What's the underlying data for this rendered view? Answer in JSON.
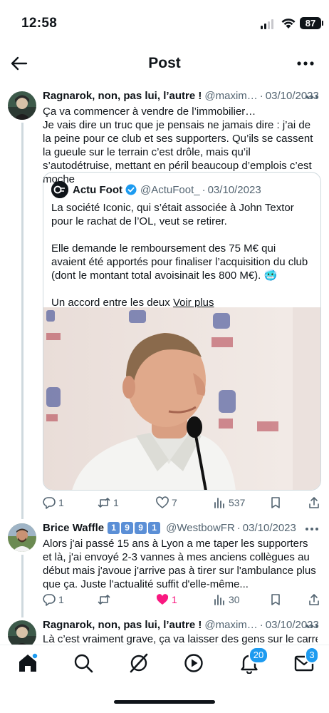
{
  "status_bar": {
    "time": "12:58",
    "battery": "87"
  },
  "header": {
    "title": "Post"
  },
  "tweets": [
    {
      "name": "Ragnarok, non, pas lui, l’autre !",
      "handle": "@maxim…",
      "date": "03/10/2023",
      "lines": [
        "Ça va commencer à vendre de l’immobilier…",
        "Je vais dire un truc que je pensais ne jamais dire : j’ai de la peine pour ce club et ses supporters. Qu’ils se cassent la gueule sur le terrain c’est drôle, mais qu’il s’autodétruise, mettant en péril beaucoup d’emplois c’est moche"
      ],
      "quote": {
        "name": "Actu Foot",
        "handle": "@ActuFoot_",
        "date": "03/10/2023",
        "para1": "La société Iconic, qui s’était associée à John Textor pour le rachat de l’OL, veut se retirer.",
        "para2": "Elle demande le remboursement des 75 M€ qui avaient été apportés pour finaliser l’acquisition du club (dont le montant total avoisinait les 800 M€). 🥶",
        "para3": "Un accord entre les deux",
        "more": "Voir plus"
      },
      "stats": {
        "replies": "1",
        "retweets": "1",
        "likes": "7",
        "views": "537"
      }
    },
    {
      "name": "Brice Waffle",
      "badges": [
        "1",
        "9",
        "9",
        "1"
      ],
      "handle": "@WestbowFR",
      "date": "03/10/2023",
      "text": "Alors j'ai passé 15 ans à Lyon a me taper les supporters et là, j'ai envoyé 2-3 vannes à mes anciens collègues au début mais j'avoue j'arrive pas à tirer sur l'ambulance plus que ça. Juste l'actualité suffit d'elle-même...",
      "stats": {
        "replies": "1",
        "retweets": "",
        "likes": "1",
        "views": "30"
      }
    },
    {
      "name": "Ragnarok, non, pas lui, l’autre !",
      "handle": "@maxim…",
      "date": "03/10/2023",
      "text": "Là c’est vraiment grave, ça va laisser des gens sur le carreau"
    }
  ],
  "tabbar": {
    "notifications_badge": "20",
    "messages_badge": "3"
  },
  "colors": {
    "accent": "#1d9bf0",
    "like": "#f91880",
    "text": "#0f1419",
    "muted": "#536471"
  }
}
